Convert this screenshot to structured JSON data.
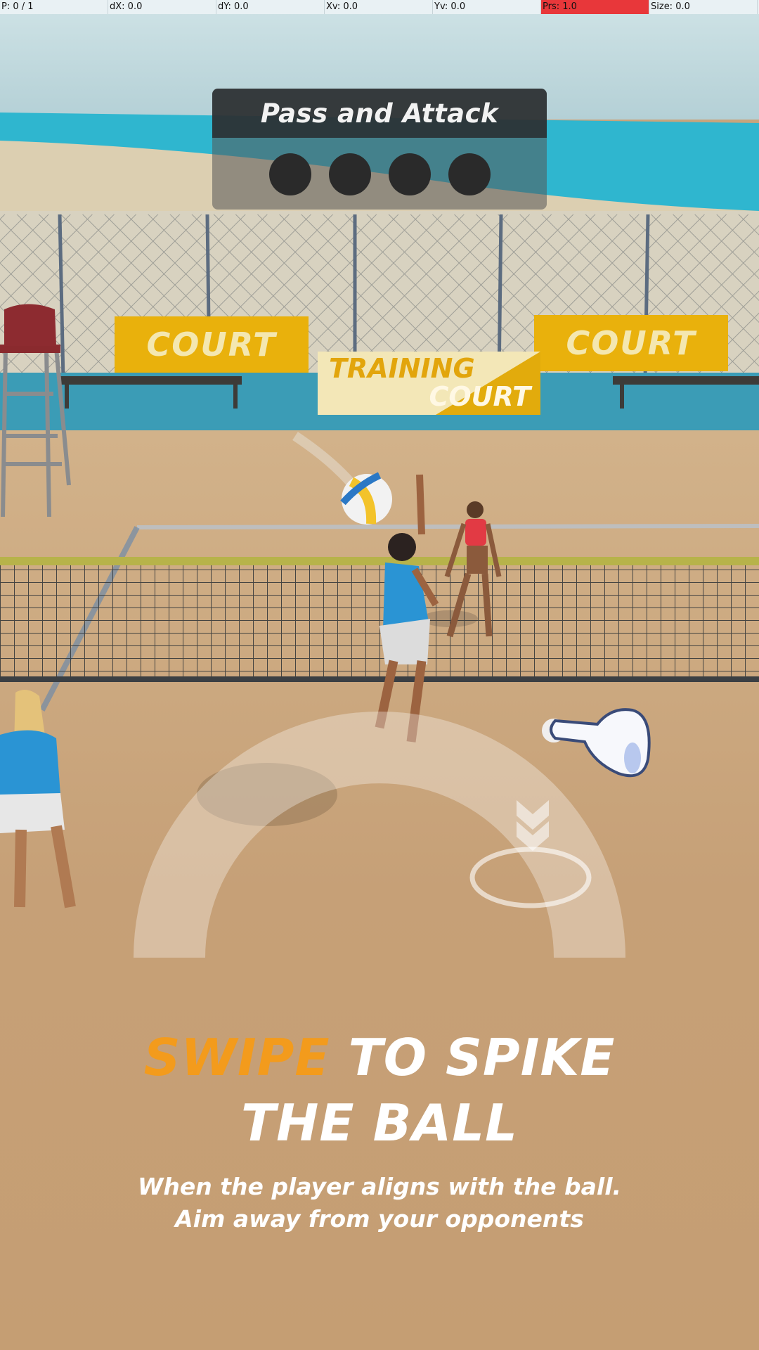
{
  "debug": {
    "cells": [
      "P: 0 / 1",
      "dX: 0.0",
      "dY: 0.0",
      "Xv: 0.0",
      "Yv: 0.0",
      "Prs: 1.0",
      "Size: 0.0"
    ]
  },
  "objective": {
    "title": "Pass and Attack",
    "progress_completed": 0,
    "progress_total": 4
  },
  "banners": {
    "left": "COURT",
    "right": "COURT",
    "center_line1": "TRAINING",
    "center_line2": "COURT"
  },
  "tutorial": {
    "headline_highlight": "SWIPE",
    "headline_rest": "TO SPIKE",
    "headline_line2": "THE BALL",
    "sub_line1": "When the player aligns with the ball.",
    "sub_line2": "Aim away from your opponents"
  },
  "colors": {
    "highlight": "#f39b1c",
    "sky": "#b9d6dc",
    "sea": "#2fb6cf",
    "sand": "#c8a47c",
    "banner": "#e9b10c",
    "debug_alert": "#e8373a"
  },
  "icons": [
    "hand-pointer-icon",
    "double-chevron-down-icon",
    "target-ring-icon",
    "volleyball-icon"
  ]
}
